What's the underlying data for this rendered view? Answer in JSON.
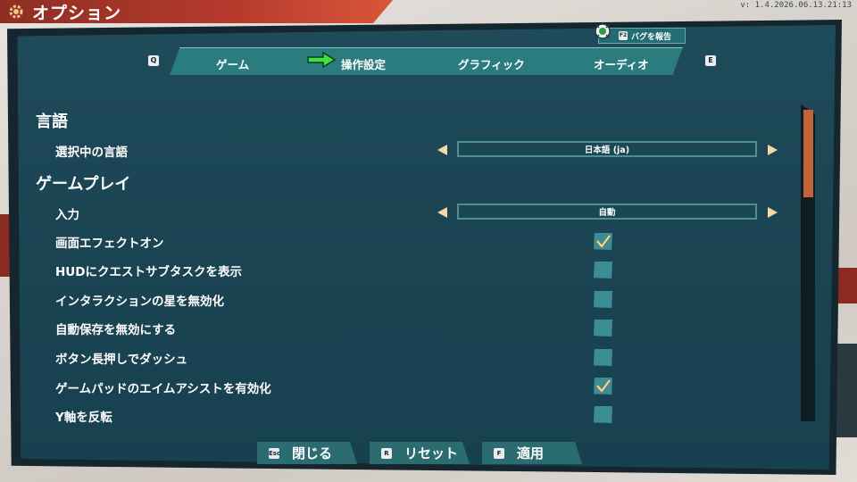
{
  "window": {
    "title": "オプション",
    "version": "v: 1.4.2026.06.13.21:13"
  },
  "bug_report": {
    "key": "F2",
    "label": "バグを報告"
  },
  "tabs": {
    "prev_key": "Q",
    "next_key": "E",
    "items": [
      {
        "label": "ゲーム"
      },
      {
        "label": "操作設定",
        "active": true
      },
      {
        "label": "グラフィック"
      },
      {
        "label": "オーディオ"
      }
    ]
  },
  "sections": {
    "language": {
      "title": "言語",
      "current_label": "選択中の言語",
      "current_value": "日本語 (ja)"
    },
    "gameplay": {
      "title": "ゲームプレイ",
      "input_label": "入力",
      "input_value": "自動",
      "options": [
        {
          "label": "画面エフェクトオン",
          "checked": true
        },
        {
          "label": "HUDにクエストサブタスクを表示",
          "checked": false
        },
        {
          "label": "インタラクションの星を無効化",
          "checked": false
        },
        {
          "label": "自動保存を無効にする",
          "checked": false
        },
        {
          "label": "ボタン長押しでダッシュ",
          "checked": false
        },
        {
          "label": "ゲームパッドのエイムアシストを有効化",
          "checked": true
        },
        {
          "label": "Y軸を反転",
          "checked": false
        }
      ]
    }
  },
  "footer": {
    "close": {
      "key": "Esc",
      "label": "閉じる"
    },
    "reset": {
      "key": "R",
      "label": "リセット"
    },
    "apply": {
      "key": "F",
      "label": "適用"
    }
  },
  "colors": {
    "panel": "#1b4453",
    "accent_orange": "#c4633b",
    "check_mark": "#f0a238",
    "arrow_green": "#3ee03a",
    "triangle": "#f2d9a6"
  },
  "icons": {
    "title": "gear-icon",
    "bug": "bug-icon",
    "active_tab": "arrow-right-icon"
  }
}
